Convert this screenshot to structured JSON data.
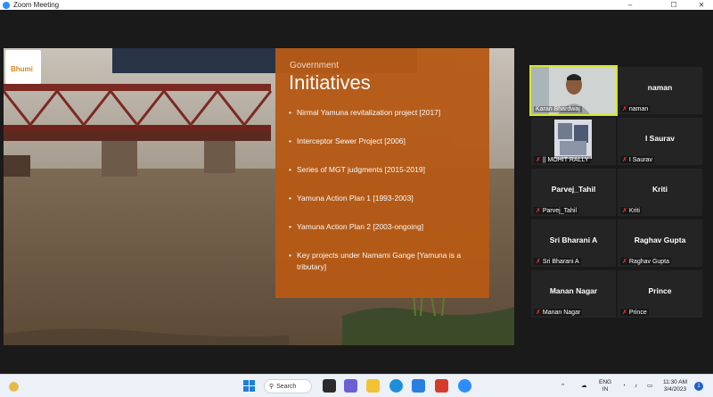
{
  "window": {
    "title": "Zoom Meeting",
    "controls": [
      "–",
      "☐",
      "✕"
    ]
  },
  "slide": {
    "logo_text": "Bhumi",
    "kicker": "Government",
    "heading": "Initiatives",
    "bullets": [
      "Nirmal Yamuna revitalization project [2017]",
      "Interceptor Sewer Project [2006]",
      "Series of MGT judgments [2015-2019]",
      "Yamuna Action Plan 1 [1993-2003]",
      "Yamuna Action Plan 2 [2003-ongoing]",
      "Key projects under Namami Gange [Yamuna is a tributary]"
    ],
    "colors": {
      "panel": "#b65a16",
      "topbar": "#283346"
    }
  },
  "participants": [
    {
      "name": "",
      "label": "Karan Bhardwaj",
      "video": true,
      "active": true,
      "muted": false
    },
    {
      "name": "naman",
      "label": "naman",
      "video": false,
      "muted": true
    },
    {
      "name": "",
      "label": "|| MOHIT RALLY",
      "video": true,
      "muted": true
    },
    {
      "name": "I Saurav",
      "label": "I Saurav",
      "video": false,
      "muted": true
    },
    {
      "name": "Parvej_Tahil",
      "label": "Parvej_Tahil",
      "video": false,
      "muted": true
    },
    {
      "name": "Kriti",
      "label": "Kriti",
      "video": false,
      "muted": true
    },
    {
      "name": "Sri Bharani A",
      "label": "Sri Bharani A",
      "video": false,
      "muted": true
    },
    {
      "name": "Raghav Gupta",
      "label": "Raghav Gupta",
      "video": false,
      "muted": true
    },
    {
      "name": "Manan Nagar",
      "label": "Manan Nagar",
      "video": false,
      "muted": true
    },
    {
      "name": "Prince",
      "label": "Prince",
      "video": false,
      "muted": true
    }
  ],
  "taskbar": {
    "search_label": "Search",
    "language_line1": "ENG",
    "language_line2": "IN",
    "time": "11:30 AM",
    "date": "3/4/2023",
    "notification_count": "1"
  }
}
